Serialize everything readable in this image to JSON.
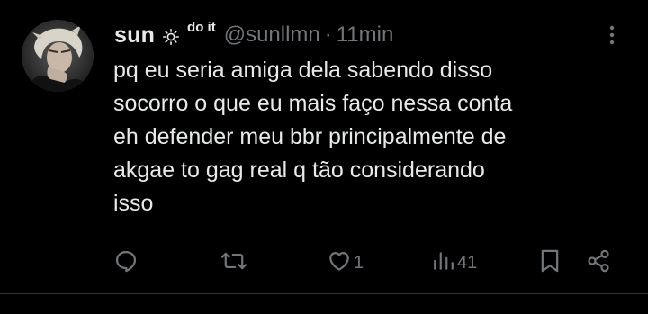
{
  "tweet": {
    "author": {
      "display_name": "sun",
      "badge_icon": "sun-icon",
      "name_suffix": "do it",
      "handle": "@sunllmn",
      "separator": "·",
      "timestamp": "11min"
    },
    "text_lines": [
      "pq eu seria amiga dela sabendo disso",
      "socorro o que eu mais faço nessa conta",
      "eh defender meu bbr principalmente de",
      "akgae to gag real q tão considerando",
      "isso"
    ],
    "actions": {
      "reply": {
        "icon": "reply-icon",
        "count": ""
      },
      "repost": {
        "icon": "repost-icon",
        "count": ""
      },
      "like": {
        "icon": "heart-icon",
        "count": "1"
      },
      "views": {
        "icon": "views-icon",
        "count": "41"
      },
      "bookmark": {
        "icon": "bookmark-icon",
        "count": ""
      },
      "share": {
        "icon": "share-icon",
        "count": ""
      }
    },
    "more_icon": "more-vertical-icon"
  },
  "colors": {
    "background": "#000000",
    "primary_text": "#e7e9ea",
    "secondary_text": "#71767b",
    "divider": "#2f3336"
  }
}
